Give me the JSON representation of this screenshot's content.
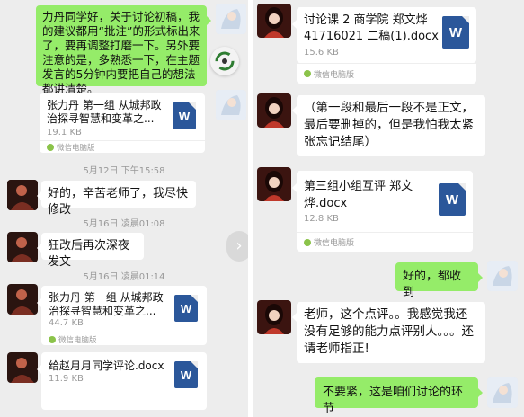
{
  "messages_left": [
    {
      "text": "力丹同学好，关于讨论初稿，我的建议都用“批注”的形式标出来了，要再调整打磨一下。另外要注意的是，多熟悉一下，在主题发言的5分钟内要把自己的想法都讲清楚。"
    },
    {
      "file_name": "张力丹 第一组 从城邦政治探寻智慧和变革之...",
      "size": "19.1 KB",
      "source": "微信电脑版"
    },
    {
      "time": "5月12日 下午15:58"
    },
    {
      "text": "好的，辛苦老师了，我尽快修改"
    },
    {
      "time": "5月16日 凌晨01:08"
    },
    {
      "text": "狂改后再次深夜发文"
    },
    {
      "time": "5月16日 凌晨01:14"
    },
    {
      "file_name": "张力丹 第一组 从城邦政治探寻智慧和变革之...",
      "size": "44.7 KB",
      "source": "微信电脑版"
    },
    {
      "file_name": "给赵月月同学评论.docx",
      "size": "11.9 KB"
    }
  ],
  "messages_right": [
    {
      "file_name": "讨论课 2 商学院 郑文烨 41716021 二稿(1).docx",
      "size": "15.6 KB",
      "source": "微信电脑版"
    },
    {
      "text": "（第一段和最后一段不是正文，最后要删掉的，但是我怕我太紧张忘记结尾）"
    },
    {
      "file_name": "第三组小组互评 郑文烨.docx",
      "size": "12.8 KB",
      "source": "微信电脑版"
    },
    {
      "text": "好的，都收到"
    },
    {
      "text": "老师，这个点评。。我感觉我还没有足够的能力点评别人。。。还请老师指正!"
    },
    {
      "text": "不要紧，这是咱们讨论的环节"
    }
  ],
  "word_icon_letter": "W",
  "colors": {
    "background": "#ededed",
    "bubble_green": "#95ec69",
    "word_blue": "#2b579a"
  }
}
